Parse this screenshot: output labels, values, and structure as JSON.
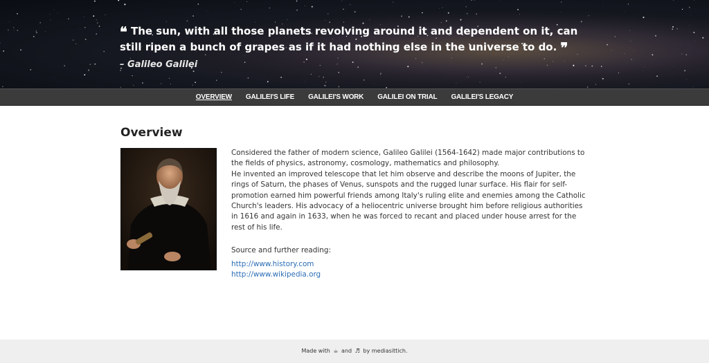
{
  "hero": {
    "quote_open": "❝",
    "quote_text": "The sun, with all those planets revolving around it and dependent on it, can still ripen a bunch of grapes as if it had nothing else in the universe to do.",
    "quote_close": "❞",
    "author": "– Galileo Galilei"
  },
  "nav": {
    "items": [
      {
        "label": "OVERVIEW"
      },
      {
        "label": "GALILEI'S LIFE"
      },
      {
        "label": "GALILEI'S WORK"
      },
      {
        "label": "GALILEI ON TRIAL"
      },
      {
        "label": "GALILEI'S LEGACY"
      }
    ]
  },
  "main": {
    "title": "Overview",
    "para1": "Considered the father of modern science, Galileo Galilei (1564-1642) made major contributions to the fields of physics, astronomy, cosmology, mathematics and philosophy.",
    "para2": "He invented an improved telescope that let him observe and describe the moons of Jupiter, the rings of Saturn, the phases of Venus, sunspots and the rugged lunar surface. His flair for self-promotion earned him powerful friends among Italy's ruling elite and enemies among the Catholic Church's leaders. His advocacy of a heliocentric universe brought him before religious authorities in 1616 and again in 1633, when he was forced to recant and placed under house arrest for the rest of his life.",
    "source_label": "Source and further reading:",
    "links": [
      {
        "label": "http://www.history.com"
      },
      {
        "label": "http://www.wikipedia.org"
      }
    ]
  },
  "footer": {
    "made_with": "Made with",
    "coffee_icon": "☕",
    "and": "and",
    "music_icon": "♬",
    "by": "by mediasittich."
  },
  "colors": {
    "nav_bg": "#3b3b3b",
    "link": "#2a6db5",
    "footer_bg": "#efefef"
  }
}
